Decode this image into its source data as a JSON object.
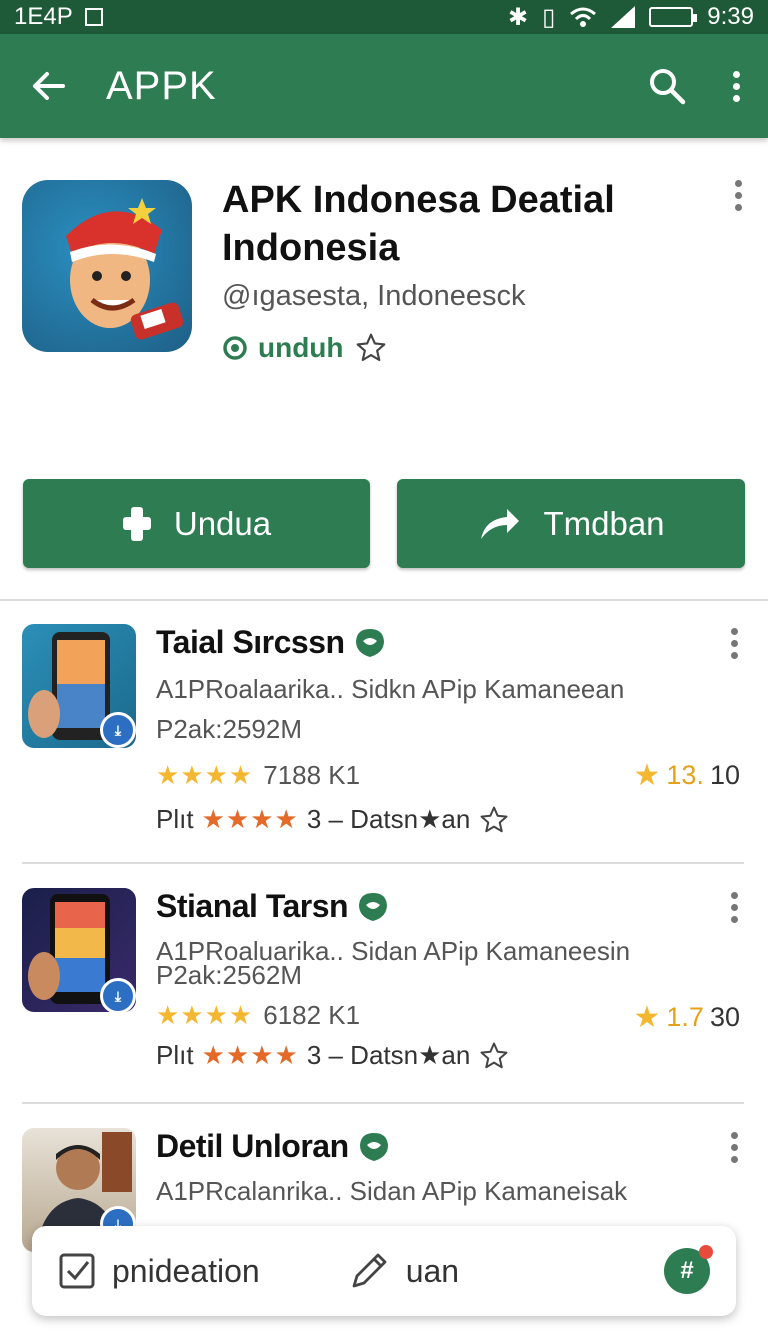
{
  "status_bar": {
    "left_text": "1E4P",
    "time": "9:39"
  },
  "app_bar": {
    "title": "APPK",
    "icons": [
      "back-arrow-icon",
      "search-icon",
      "more-vert-icon"
    ]
  },
  "app_header": {
    "title": "APK Indonesa Deatial Indonesia",
    "developer": "@ıgasesta, Indoneesck",
    "download_label": "unduh",
    "icons": [
      "download-cycle-icon",
      "star-outline-icon",
      "more-vert-icon"
    ]
  },
  "actions": {
    "primary": {
      "label": "Undua",
      "icon": "plus-icon"
    },
    "secondary": {
      "label": "Tmdban",
      "icon": "share-arrow-icon"
    }
  },
  "colors": {
    "status_bar": "#1f5a38",
    "app_bar": "#2e7d52",
    "button": "#2e7d52",
    "star": "#f4b731",
    "os_stars": "#e46a2a"
  },
  "list": [
    {
      "title": "Taial Sırcssn",
      "desc": "A1PRoalaarika.. Sidkn APip Kamaneean",
      "size": "P2ak:2592M",
      "stars_text": "★★★★",
      "downloads": "7188 K1",
      "rating_main": "13.",
      "rating_extra": "10",
      "plt_label": "Plıt",
      "plt_stars": "★★★★",
      "plt_text": "3 – Datsn★an"
    },
    {
      "title": "Stianal Tarsn",
      "desc": "A1PRoaluarika.. Sidan APip Kamaneesin",
      "size": "P2ak:2562M",
      "stars_text": "★★★★",
      "downloads": "6182 K1",
      "rating_main": "1.7",
      "rating_extra": "30",
      "plt_label": "Plıt",
      "plt_stars": "★★★★",
      "plt_text": "3 – Datsn★an"
    },
    {
      "title": "Detil Unloran",
      "desc": "A1PRcalanrika.. Sidan APip Kamaneisak"
    }
  ],
  "bottom_bar": {
    "item1": "pnideation",
    "item2": "uan",
    "fab_label": "#"
  }
}
